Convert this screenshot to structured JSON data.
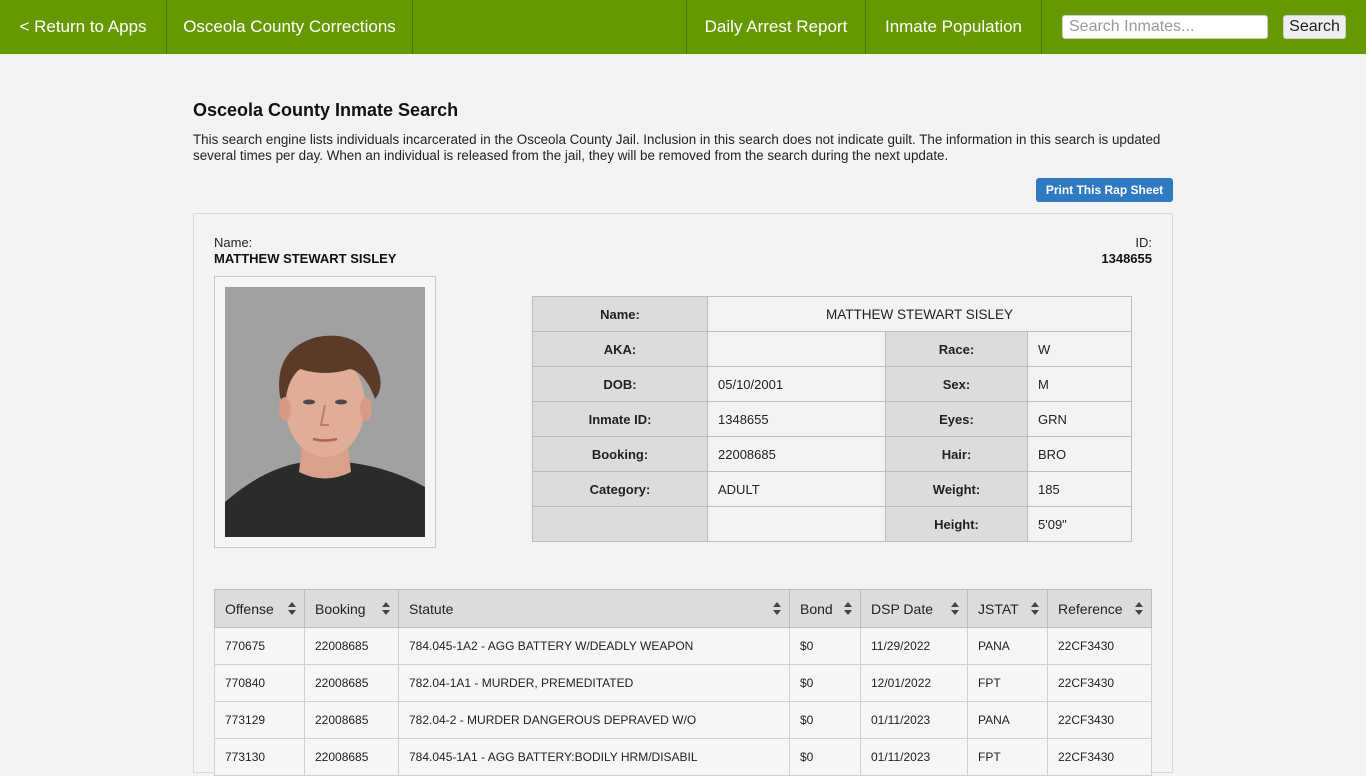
{
  "nav": {
    "return_label": "< Return to Apps",
    "brand": "Osceola County Corrections",
    "daily_arrest": "Daily Arrest Report",
    "inmate_population": "Inmate Population",
    "search_placeholder": "Search Inmates...",
    "search_button": "Search"
  },
  "page": {
    "title": "Osceola County Inmate Search",
    "intro": "This search engine lists individuals incarcerated in the Osceola County Jail. Inclusion in this search does not indicate guilt. The information in this search is updated several times per day. When an individual is released from the jail, they will be removed from the search during the next update.",
    "print_button": "Print This Rap Sheet"
  },
  "inmate": {
    "name_label": "Name:",
    "name": "MATTHEW STEWART SISLEY",
    "id_label": "ID:",
    "id": "1348655"
  },
  "details": {
    "name_label": "Name:",
    "name": "MATTHEW STEWART SISLEY",
    "aka_label": "AKA:",
    "aka": "",
    "dob_label": "DOB:",
    "dob": "05/10/2001",
    "inmate_id_label": "Inmate ID:",
    "inmate_id": "1348655",
    "booking_label": "Booking:",
    "booking": "22008685",
    "category_label": "Category:",
    "category": "ADULT",
    "race_label": "Race:",
    "race": "W",
    "sex_label": "Sex:",
    "sex": "M",
    "eyes_label": "Eyes:",
    "eyes": "GRN",
    "hair_label": "Hair:",
    "hair": "BRO",
    "weight_label": "Weight:",
    "weight": "185",
    "height_label": "Height:",
    "height": "5'09\""
  },
  "offenses": {
    "headers": [
      "Offense",
      "Booking",
      "Statute",
      "Bond",
      "DSP Date",
      "JSTAT",
      "Reference"
    ],
    "rows": [
      [
        "770675",
        "22008685",
        "784.045-1A2 - AGG BATTERY W/DEADLY WEAPON",
        "$0",
        "11/29/2022",
        "PANA",
        "22CF3430"
      ],
      [
        "770840",
        "22008685",
        "782.04-1A1 - MURDER, PREMEDITATED",
        "$0",
        "12/01/2022",
        "FPT",
        "22CF3430"
      ],
      [
        "773129",
        "22008685",
        "782.04-2 - MURDER DANGEROUS DEPRAVED W/O",
        "$0",
        "01/11/2023",
        "PANA",
        "22CF3430"
      ],
      [
        "773130",
        "22008685",
        "784.045-1A1 - AGG BATTERY:BODILY HRM/DISABIL",
        "$0",
        "01/11/2023",
        "FPT",
        "22CF3430"
      ]
    ]
  },
  "colors": {
    "nav_green": "#669900",
    "print_blue": "#2f7ac0"
  }
}
